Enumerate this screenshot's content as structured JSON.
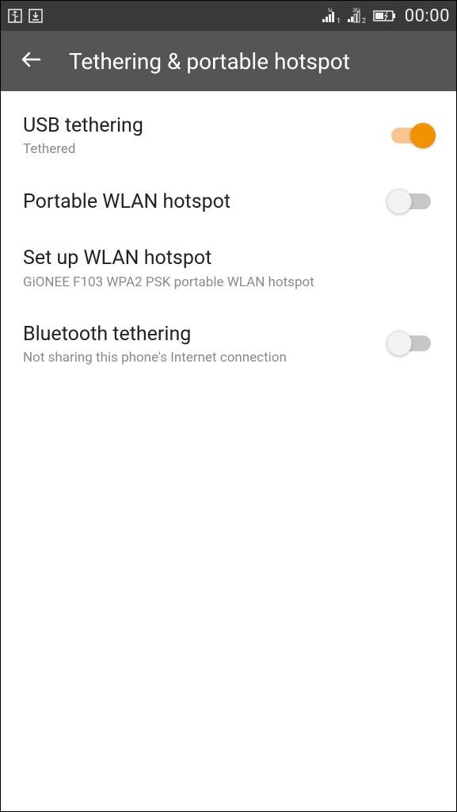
{
  "status": {
    "clock": "00:00",
    "signal1_label": "G",
    "signal1_sub": "1",
    "signal2_label": "3G",
    "signal2_sub": "2"
  },
  "header": {
    "title": "Tethering & portable hotspot"
  },
  "items": [
    {
      "title": "USB tethering",
      "subtitle": "Tethered",
      "toggle": "on"
    },
    {
      "title": "Portable WLAN hotspot",
      "subtitle": "",
      "toggle": "off"
    },
    {
      "title": "Set up WLAN hotspot",
      "subtitle": "GiONEE F103 WPA2 PSK portable WLAN hotspot",
      "toggle": ""
    },
    {
      "title": "Bluetooth tethering",
      "subtitle": "Not sharing this phone's Internet connection",
      "toggle": "off"
    }
  ]
}
